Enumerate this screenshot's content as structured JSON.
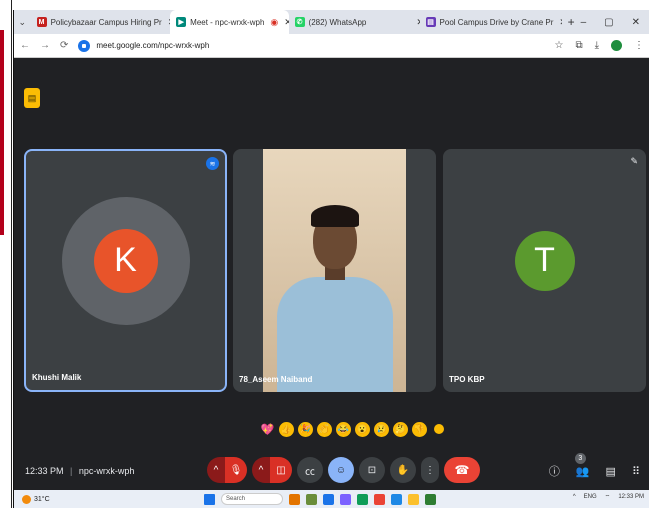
{
  "browser": {
    "tabs": [
      {
        "label": "Policybazaar Campus Hiring Pr",
        "fav_color": "#c5221f",
        "fav_glyph": "M"
      },
      {
        "label": "Meet - npc-wrxk-wph",
        "fav_color": "#00897b",
        "fav_glyph": "▶",
        "active": true
      },
      {
        "label": "(282) WhatsApp",
        "fav_color": "#25d366",
        "fav_glyph": "✆"
      },
      {
        "label": "Pool Campus Drive by Crane Pr",
        "fav_color": "#673ab7",
        "fav_glyph": "▤"
      }
    ],
    "new_tab": "+",
    "url": "meet.google.com/npc-wrxk-wph",
    "profile_color": "#1e8e3e"
  },
  "meet": {
    "participants": [
      {
        "name": "Khushi Malik",
        "initial": "K",
        "avatar_color": "#e8542a",
        "speaking": true
      },
      {
        "name": "78_Aseem Naiband",
        "video": true
      },
      {
        "name": "TPO KBP",
        "initial": "T",
        "avatar_color": "#5b9a2e",
        "muted": true
      }
    ],
    "reactions": [
      "💖",
      "👍",
      "🎉",
      "👏",
      "😂",
      "😮",
      "😢",
      "🤔",
      "👎"
    ],
    "time": "12:33 PM",
    "meeting_code": "npc-wrxk-wph",
    "people_count": "3"
  },
  "taskbar": {
    "weather": "31°C",
    "search_placeholder": "Search",
    "lang": "ENG",
    "clock": "12:33 PM"
  }
}
